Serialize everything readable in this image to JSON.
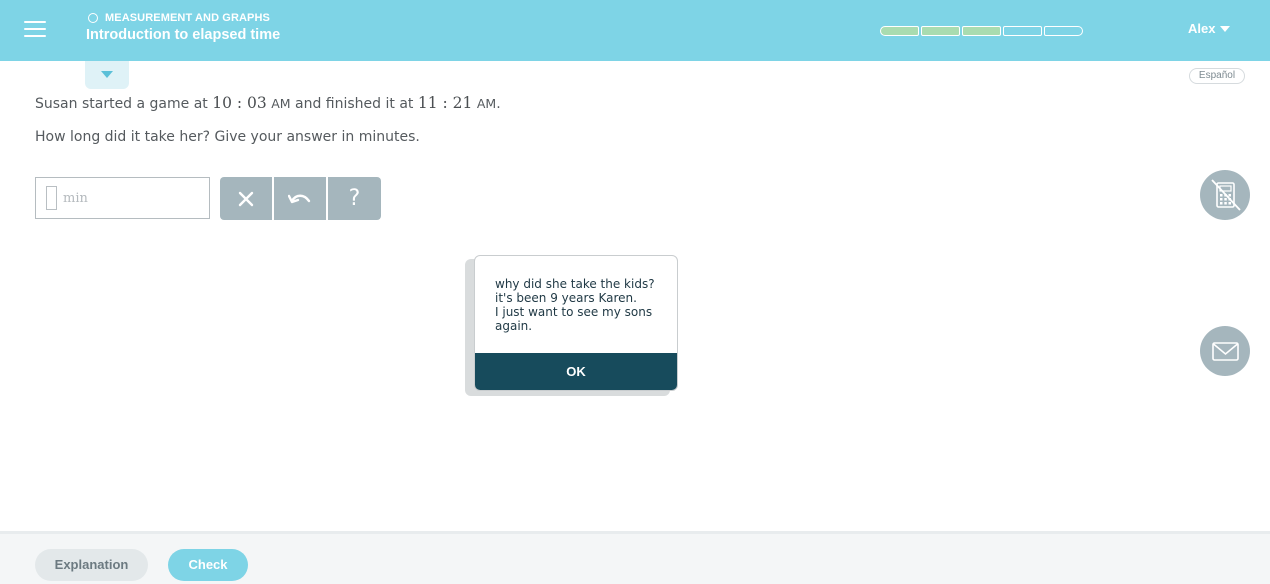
{
  "header": {
    "breadcrumb": "MEASUREMENT AND GRAPHS",
    "topic_title": "Introduction to elapsed time",
    "progress": {
      "filled_segments": 3,
      "total_segments": 5
    },
    "user_name": "Alex",
    "colors": {
      "bar": "#7ed4e6",
      "progress_filled": "#a9dcb0"
    }
  },
  "language_link": "Español",
  "question": {
    "line1_prefix": "Susan started a game at ",
    "start_time": "10 : 03",
    "start_ampm": "AM",
    "line1_mid": " and finished it at ",
    "end_time": "11 : 21",
    "end_ampm": "AM",
    "line1_suffix": ".",
    "line2": "How long did it take her? Give your answer in minutes."
  },
  "answer": {
    "value": "",
    "unit": "min"
  },
  "tools": {
    "clear": "×",
    "undo_icon": "undo-icon",
    "help": "?"
  },
  "side_tools": [
    "calculator-disabled-icon",
    "mail-icon"
  ],
  "dialog": {
    "lines": [
      "why did she take the kids?",
      "it's been 9 years Karen.",
      "I just want to see my sons",
      "again."
    ],
    "ok_label": "OK"
  },
  "footer": {
    "explanation_label": "Explanation",
    "check_label": "Check"
  }
}
